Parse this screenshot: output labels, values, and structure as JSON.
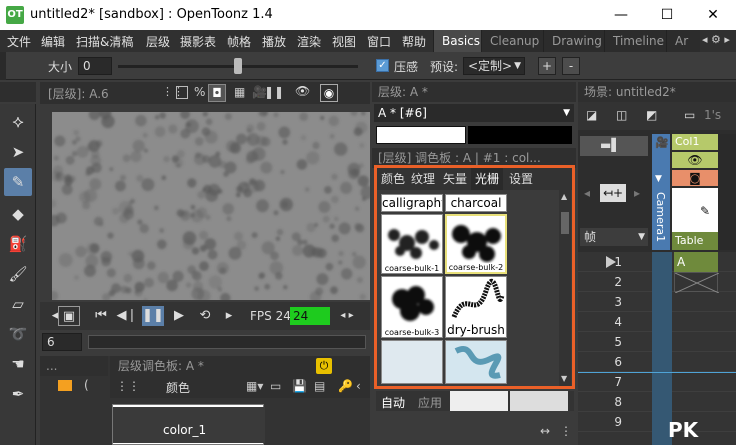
{
  "window": {
    "title": "untitled2* [sandbox] : OpenToonz 1.4",
    "logo": "OT",
    "minimize": "—",
    "maximize": "☐",
    "close": "✕"
  },
  "menu": [
    "文件",
    "编辑",
    "扫描&清稿",
    "层级",
    "摄影表",
    "帧格",
    "播放",
    "渲染",
    "视图",
    "窗口",
    "帮助"
  ],
  "rooms": [
    {
      "label": "Basics",
      "active": true
    },
    {
      "label": "Cleanup",
      "active": false
    },
    {
      "label": "Drawing",
      "active": false
    },
    {
      "label": "Timeline",
      "active": false
    },
    {
      "label": "Ar",
      "active": false
    }
  ],
  "tool_options": {
    "size_label": "大小",
    "size_value": "0",
    "pressure_label": "压感",
    "pressure_checked": true,
    "preset_label": "预设:",
    "preset_value": "<定制>",
    "add": "+",
    "remove": "-"
  },
  "viewer": {
    "title": "[层级]: A.6",
    "fps_label": "FPS 24/",
    "fps_value": "24",
    "frame": "6"
  },
  "level_palette": {
    "title": "层级调色板: A *",
    "tab_color": "颜色",
    "swatch": "color_1",
    "more": "..."
  },
  "style_editor": {
    "title": "层级: A *",
    "style_name": "A * [#6]",
    "palette_title": "[层级] 调色板 : A | #1 : col...",
    "tabs": [
      {
        "label": "颜色",
        "active": false
      },
      {
        "label": "纹理",
        "active": false
      },
      {
        "label": "矢量",
        "active": false
      },
      {
        "label": "光栅",
        "active": true
      },
      {
        "label": "设置",
        "active": false
      }
    ],
    "brushes": [
      "calligraphy",
      "charcoal",
      "coarse-bulk-1",
      "coarse-bulk-2",
      "coarse-bulk-3",
      "dry-brush"
    ],
    "bottom_auto": "自动",
    "bottom_apply": "应用"
  },
  "xsheet": {
    "title": "场景: untitled2*",
    "col_name": "Col1",
    "camera": "Camera1",
    "table": "Table",
    "frame_label": "帧",
    "fps_short": "1's",
    "cell": "A",
    "rows": [
      "1",
      "2",
      "3",
      "4",
      "5",
      "6",
      "7",
      "8",
      "9"
    ]
  },
  "watermark": "PK"
}
